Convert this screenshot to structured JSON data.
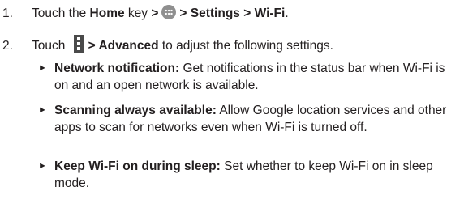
{
  "steps": [
    {
      "number": "1.",
      "t1": "Touch the ",
      "home": "Home",
      "t2": " key ",
      "sep1": ">",
      "sep2": "> Settings > Wi-Fi",
      "end": ".",
      "icon": "apps-icon"
    },
    {
      "number": "2.",
      "t1": "Touch ",
      "bold": "> Advanced",
      "t2": " to adjust the following settings.",
      "icon": "menu-icon"
    }
  ],
  "bullets": [
    {
      "title": "Network notification:",
      "text": " Get notifications in the status bar when Wi-Fi is on and an open network is available."
    },
    {
      "title": "Scanning always available:",
      "text": " Allow Google location services and other apps to scan for networks even when Wi-Fi is turned off."
    },
    {
      "title": "Keep Wi-Fi on during sleep:",
      "text": " Set whether to keep Wi-Fi on in sleep mode."
    }
  ],
  "bullet_glyph": "►"
}
